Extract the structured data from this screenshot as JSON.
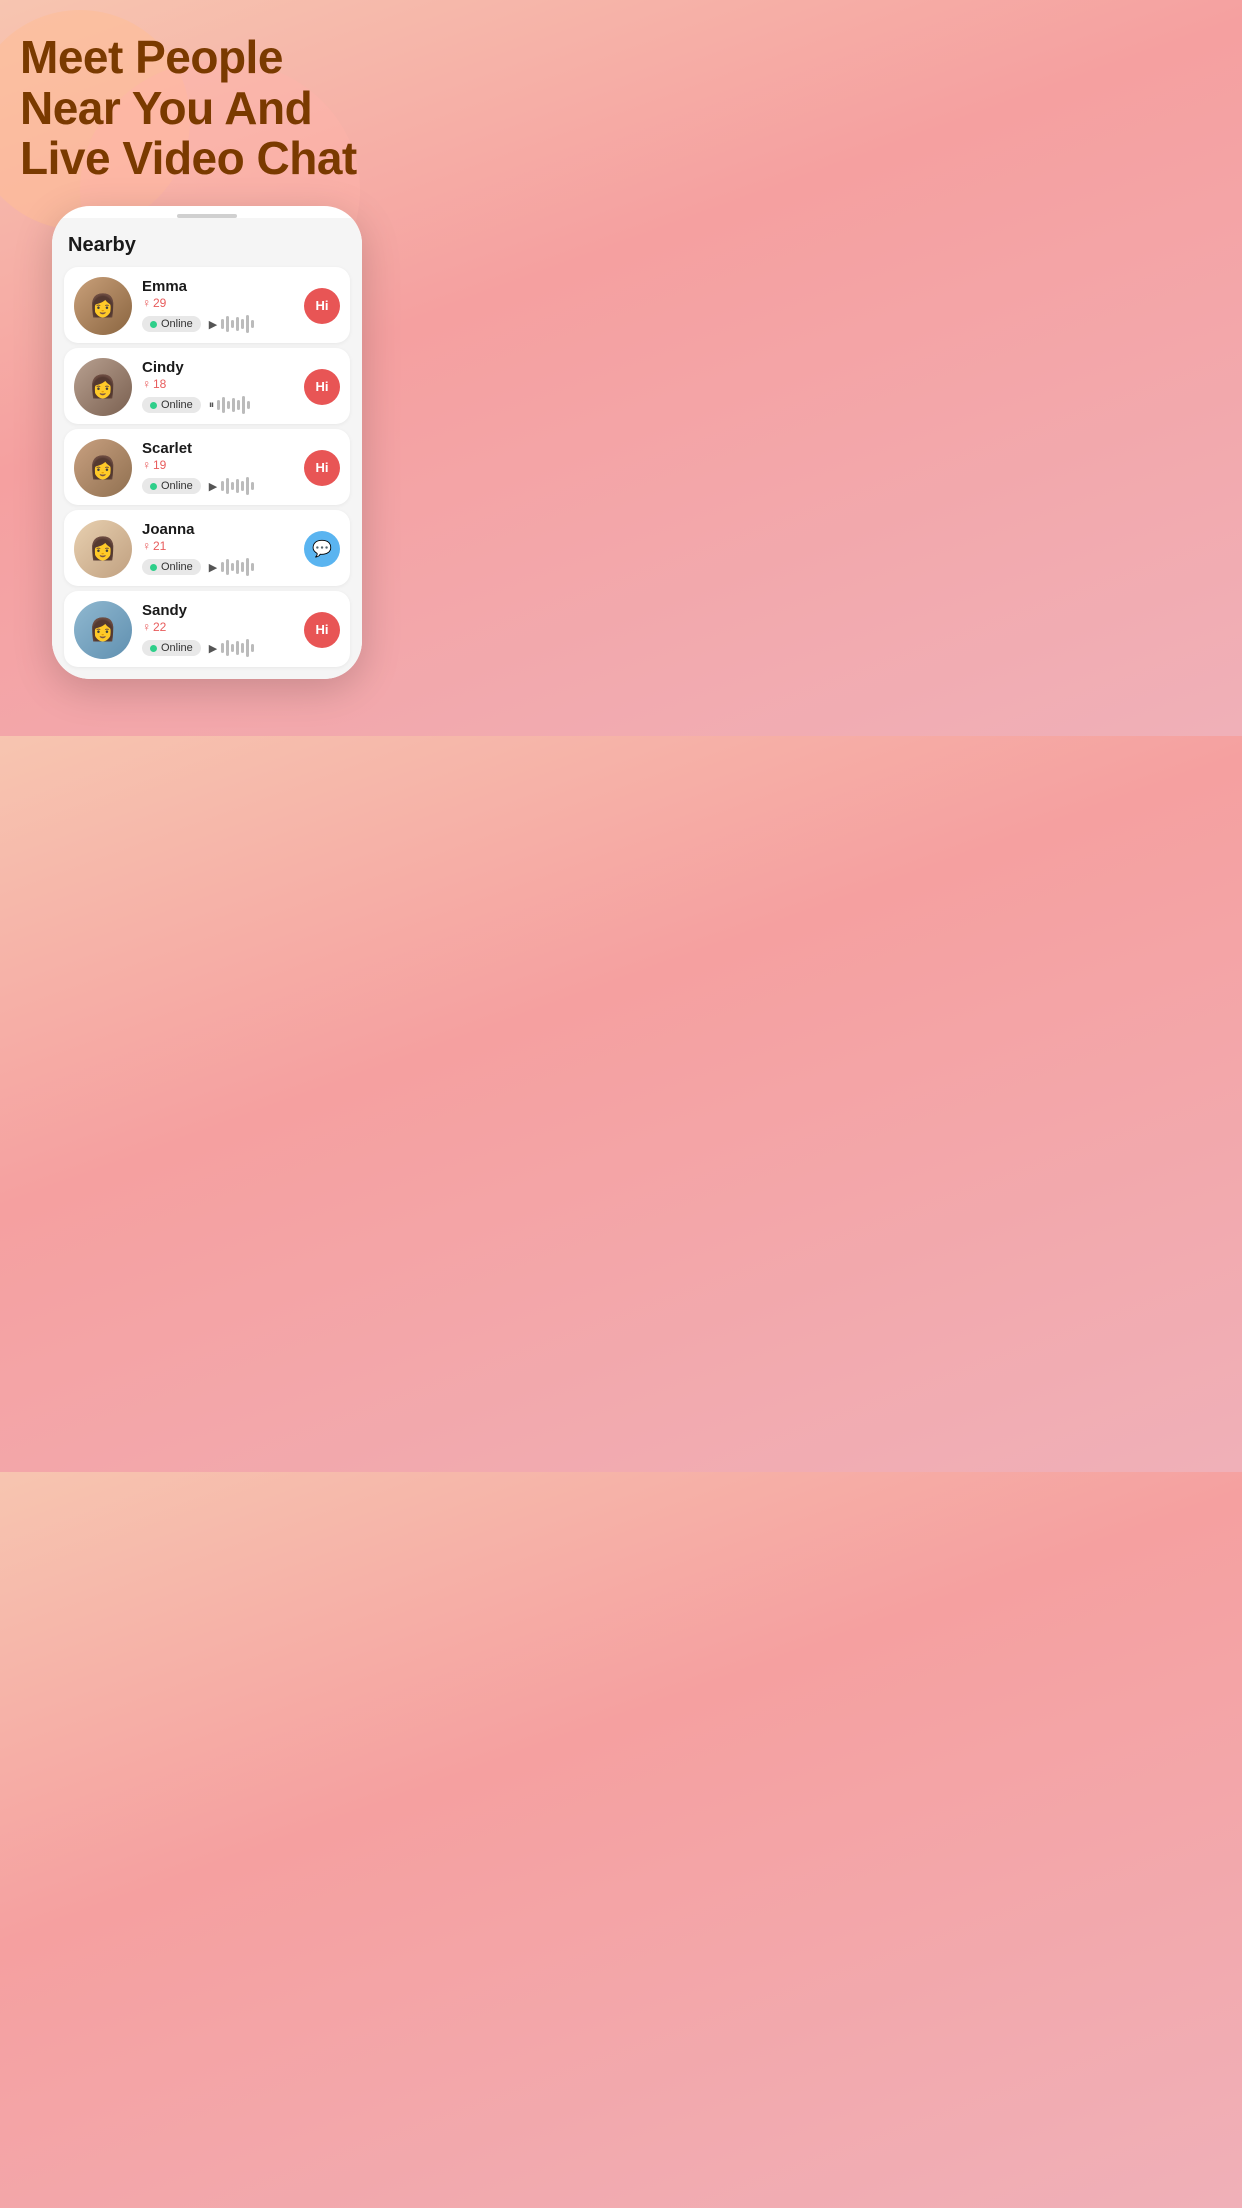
{
  "hero": {
    "title_line1": "Meet People",
    "title_line2": "Near You And",
    "title_line3": "Live Video Chat"
  },
  "screen": {
    "title": "Nearby"
  },
  "users": [
    {
      "id": "emma",
      "name": "Emma",
      "gender": "♀",
      "age": "29",
      "status": "Online",
      "action_type": "hi",
      "action_label": "Hi",
      "is_paused": false,
      "avatar_class": "avatar-emma",
      "avatar_emoji": "👩"
    },
    {
      "id": "cindy",
      "name": "Cindy",
      "gender": "♀",
      "age": "18",
      "status": "Online",
      "action_type": "hi",
      "action_label": "Hi",
      "is_paused": true,
      "avatar_class": "avatar-cindy",
      "avatar_emoji": "👩"
    },
    {
      "id": "scarlet",
      "name": "Scarlet",
      "gender": "♀",
      "age": "19",
      "status": "Online",
      "action_type": "hi",
      "action_label": "Hi",
      "is_paused": false,
      "avatar_class": "avatar-scarlet",
      "avatar_emoji": "👩"
    },
    {
      "id": "joanna",
      "name": "Joanna",
      "gender": "♀",
      "age": "21",
      "status": "Online",
      "action_type": "chat",
      "action_label": "💬",
      "is_paused": false,
      "avatar_class": "avatar-joanna",
      "avatar_emoji": "👩"
    },
    {
      "id": "sandy",
      "name": "Sandy",
      "gender": "♀",
      "age": "22",
      "status": "Online",
      "action_type": "hi",
      "action_label": "Hi",
      "is_paused": false,
      "avatar_class": "avatar-sandy",
      "avatar_emoji": "👩"
    }
  ],
  "colors": {
    "hi_button": "#e85555",
    "chat_button": "#5ab4f0",
    "online_dot": "#2ecf8a",
    "female_color": "#e85c5c",
    "title_color": "#7a3a00"
  }
}
